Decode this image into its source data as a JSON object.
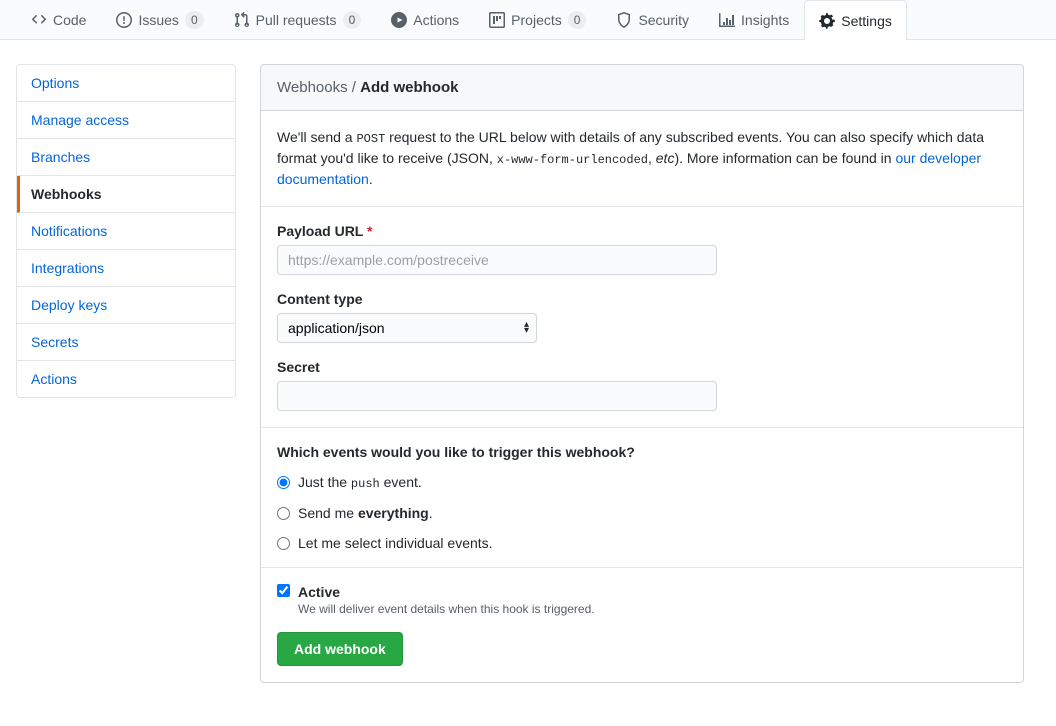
{
  "tabs": {
    "code": "Code",
    "issues": "Issues",
    "issues_count": "0",
    "pulls": "Pull requests",
    "pulls_count": "0",
    "actions": "Actions",
    "projects": "Projects",
    "projects_count": "0",
    "security": "Security",
    "insights": "Insights",
    "settings": "Settings"
  },
  "sidebar": {
    "items": [
      "Options",
      "Manage access",
      "Branches",
      "Webhooks",
      "Notifications",
      "Integrations",
      "Deploy keys",
      "Secrets",
      "Actions"
    ]
  },
  "breadcrumb": {
    "root": "Webhooks",
    "sep": " / ",
    "current": "Add webhook"
  },
  "intro": {
    "t1": "We'll send a ",
    "code1": "POST",
    "t2": " request to the URL below with details of any subscribed events. You can also specify which data format you'd like to receive (JSON, ",
    "code2": "x-www-form-urlencoded",
    "t3": ", ",
    "em": "etc",
    "t4": "). More information can be found in ",
    "link": "our developer documentation",
    "t5": "."
  },
  "payload": {
    "label": "Payload URL",
    "placeholder": "https://example.com/postreceive"
  },
  "content_type": {
    "label": "Content type",
    "value": "application/json"
  },
  "secret": {
    "label": "Secret"
  },
  "events": {
    "heading": "Which events would you like to trigger this webhook?",
    "o1a": "Just the ",
    "o1b": "push",
    "o1c": " event.",
    "o2a": "Send me ",
    "o2b": "everything",
    "o2c": ".",
    "o3": "Let me select individual events."
  },
  "active": {
    "label": "Active",
    "note": "We will deliver event details when this hook is triggered."
  },
  "submit": "Add webhook"
}
